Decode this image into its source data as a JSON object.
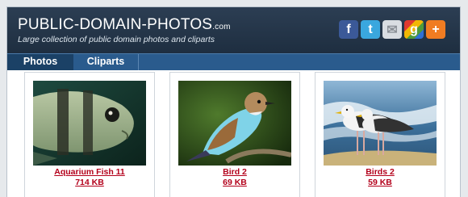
{
  "site": {
    "logo_text": "PUBLIC-DOMAIN-PHOTOS",
    "logo_suffix": ".com",
    "tagline": "Large collection of public domain photos and cliparts"
  },
  "social": [
    {
      "name": "facebook-icon",
      "glyph": "f",
      "color": "#3b5998"
    },
    {
      "name": "twitter-icon",
      "glyph": "t",
      "color": "#3aa7de"
    },
    {
      "name": "email-icon",
      "glyph": "✉",
      "color": "#d9dde2"
    },
    {
      "name": "google-icon",
      "glyph": "g",
      "color": "#4e9b3a"
    },
    {
      "name": "add-icon",
      "glyph": "+",
      "color": "#f07c22"
    }
  ],
  "nav": {
    "tabs": [
      {
        "label": "Photos",
        "active": true
      },
      {
        "label": "Cliparts",
        "active": false
      }
    ]
  },
  "photos": [
    {
      "title": "Aquarium Fish 11",
      "size": "714 KB",
      "image": "fish"
    },
    {
      "title": "Bird 2",
      "size": "69 KB",
      "image": "roller-bird"
    },
    {
      "title": "Birds 2",
      "size": "59 KB",
      "image": "seagulls"
    }
  ]
}
